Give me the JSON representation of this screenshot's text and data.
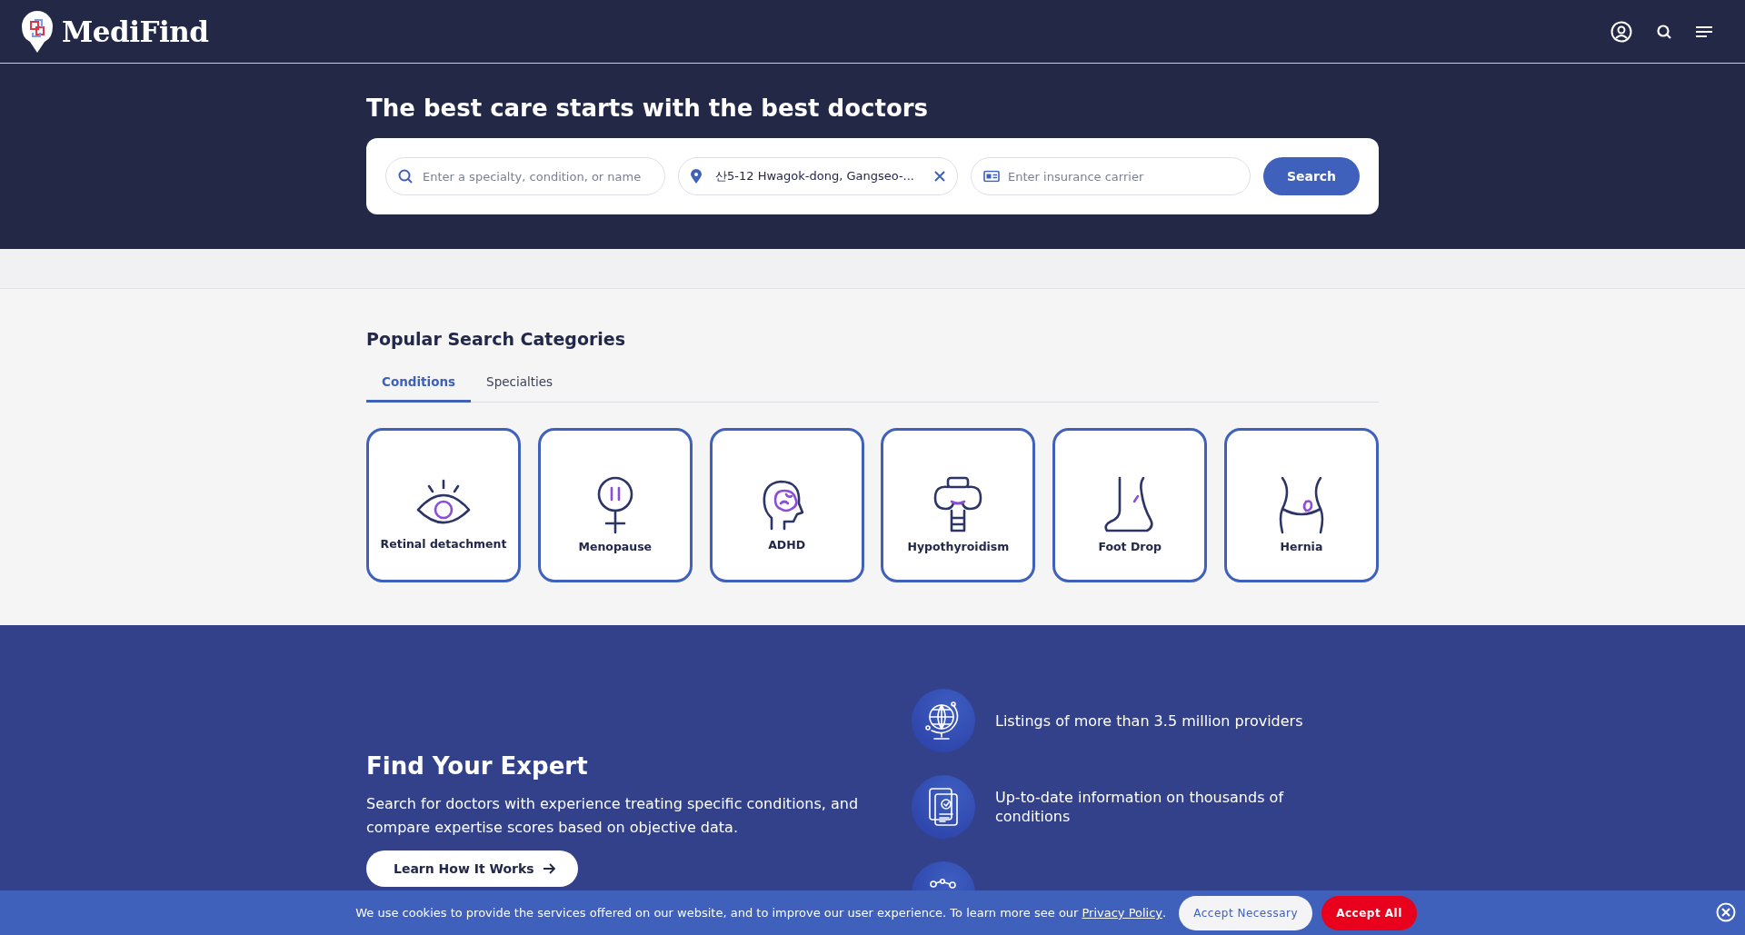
{
  "header": {
    "logo": "MediFind"
  },
  "hero": {
    "title": "The best care starts with the best doctors",
    "search": {
      "specialty": {
        "placeholder": "Enter a specialty, condition, or name"
      },
      "location": {
        "value": "산5-12 Hwagok-dong, Gangseo-..."
      },
      "insurance": {
        "placeholder": "Enter insurance carrier"
      },
      "button": "Search"
    }
  },
  "categories": {
    "title": "Popular Search Categories",
    "tabs": [
      {
        "label": "Conditions",
        "selected": true
      },
      {
        "label": "Specialties",
        "selected": false
      }
    ],
    "items": [
      {
        "label": "Retinal detachment"
      },
      {
        "label": "Menopause"
      },
      {
        "label": "ADHD"
      },
      {
        "label": "Hypothyroidism"
      },
      {
        "label": "Foot Drop"
      },
      {
        "label": "Hernia"
      }
    ]
  },
  "expert": {
    "title": "Find Your Expert",
    "text": "Search for doctors with experience treating specific conditions, and compare expertise scores based on objective data.",
    "button": "Learn How It Works",
    "features": [
      {
        "text": "Listings of more than 3.5 million providers"
      },
      {
        "text": "Up-to-date information on thousands of conditions"
      }
    ]
  },
  "cookie_bar": {
    "text": "We use cookies to provide the services offered on our website, and to improve our user experience. To learn more see our",
    "link": "Privacy Policy",
    "link_suffix": ".",
    "buttons": [
      {
        "label": "Accept Necessary",
        "kind": "secondary"
      },
      {
        "label": "Accept All",
        "kind": "primary"
      }
    ]
  }
}
